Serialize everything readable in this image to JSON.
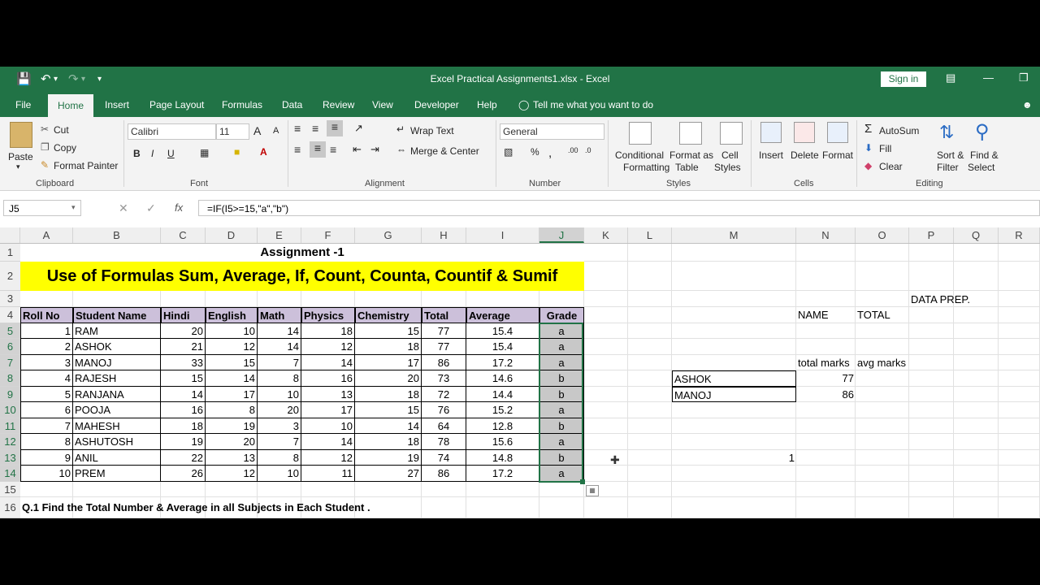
{
  "window": {
    "title": "Excel Practical Assignments1.xlsx  -  Excel",
    "sign_in": "Sign in"
  },
  "tabs": [
    "File",
    "Home",
    "Insert",
    "Page Layout",
    "Formulas",
    "Data",
    "Review",
    "View",
    "Developer",
    "Help"
  ],
  "tell_me": "Tell me what you want to do",
  "ribbon": {
    "clipboard": {
      "paste": "Paste",
      "cut": "Cut",
      "copy": "Copy",
      "format_painter": "Format Painter",
      "label": "Clipboard"
    },
    "font": {
      "name": "Calibri",
      "size": "11",
      "bold": "B",
      "italic": "I",
      "underline": "U",
      "label": "Font"
    },
    "alignment": {
      "wrap_text": "Wrap Text",
      "merge_center": "Merge & Center",
      "label": "Alignment"
    },
    "number": {
      "format": "General",
      "label": "Number"
    },
    "styles": {
      "conditional1": "Conditional",
      "conditional2": "Formatting",
      "format_as1": "Format as",
      "format_as2": "Table",
      "cell1": "Cell",
      "cell2": "Styles",
      "label": "Styles"
    },
    "cells": {
      "insert": "Insert",
      "delete": "Delete",
      "format": "Format",
      "label": "Cells"
    },
    "editing": {
      "autosum": "AutoSum",
      "fill": "Fill",
      "clear": "Clear",
      "sort1": "Sort &",
      "sort2": "Filter",
      "find1": "Find &",
      "find2": "Select",
      "label": "Editing"
    }
  },
  "formula_bar": {
    "name_box": "J5",
    "fx": "fx",
    "formula": "=IF(I5>=15,\"a\",\"b\")"
  },
  "columns": [
    "A",
    "B",
    "C",
    "D",
    "E",
    "F",
    "G",
    "H",
    "I",
    "J",
    "K",
    "L",
    "M",
    "N",
    "O",
    "P",
    "Q",
    "R"
  ],
  "rows": [
    "1",
    "2",
    "3",
    "4",
    "5",
    "6",
    "7",
    "8",
    "9",
    "10",
    "11",
    "12",
    "13",
    "14",
    "15",
    "16"
  ],
  "sheet": {
    "title": "Assignment -1",
    "banner": "Use of Formulas Sum, Average, If, Count, Counta, Countif & Sumif",
    "headers": [
      "Roll No",
      "Student Name",
      "Hindi",
      "English",
      "Math",
      "Physics",
      "Chemistry",
      "Total",
      "Average",
      "Grade"
    ],
    "records": [
      [
        "1",
        "RAM",
        "20",
        "10",
        "14",
        "18",
        "15",
        "77",
        "15.4",
        "a"
      ],
      [
        "2",
        "ASHOK",
        "21",
        "12",
        "14",
        "12",
        "18",
        "77",
        "15.4",
        "a"
      ],
      [
        "3",
        "MANOJ",
        "33",
        "15",
        "7",
        "14",
        "17",
        "86",
        "17.2",
        "a"
      ],
      [
        "4",
        "RAJESH",
        "15",
        "14",
        "8",
        "16",
        "20",
        "73",
        "14.6",
        "b"
      ],
      [
        "5",
        "RANJANA",
        "14",
        "17",
        "10",
        "13",
        "18",
        "72",
        "14.4",
        "b"
      ],
      [
        "6",
        "POOJA",
        "16",
        "8",
        "20",
        "17",
        "15",
        "76",
        "15.2",
        "a"
      ],
      [
        "7",
        "MAHESH",
        "18",
        "19",
        "3",
        "10",
        "14",
        "64",
        "12.8",
        "b"
      ],
      [
        "8",
        "ASHUTOSH",
        "19",
        "20",
        "7",
        "14",
        "18",
        "78",
        "15.6",
        "a"
      ],
      [
        "9",
        "ANIL",
        "22",
        "13",
        "8",
        "12",
        "19",
        "74",
        "14.8",
        "b"
      ],
      [
        "10",
        "PREM",
        "26",
        "12",
        "10",
        "11",
        "27",
        "86",
        "17.2",
        "a"
      ]
    ],
    "data_prep": "DATA PREP.",
    "name_label": "NAME",
    "total_label": "TOTAL",
    "total_marks": "total marks",
    "avg_marks": "avg marks",
    "lookup": [
      {
        "name": "ASHOK",
        "value": "77"
      },
      {
        "name": "MANOJ",
        "value": "86"
      }
    ],
    "n13": "1",
    "question": "Q.1 Find the Total Number & Average in all Subjects in Each Student ."
  }
}
